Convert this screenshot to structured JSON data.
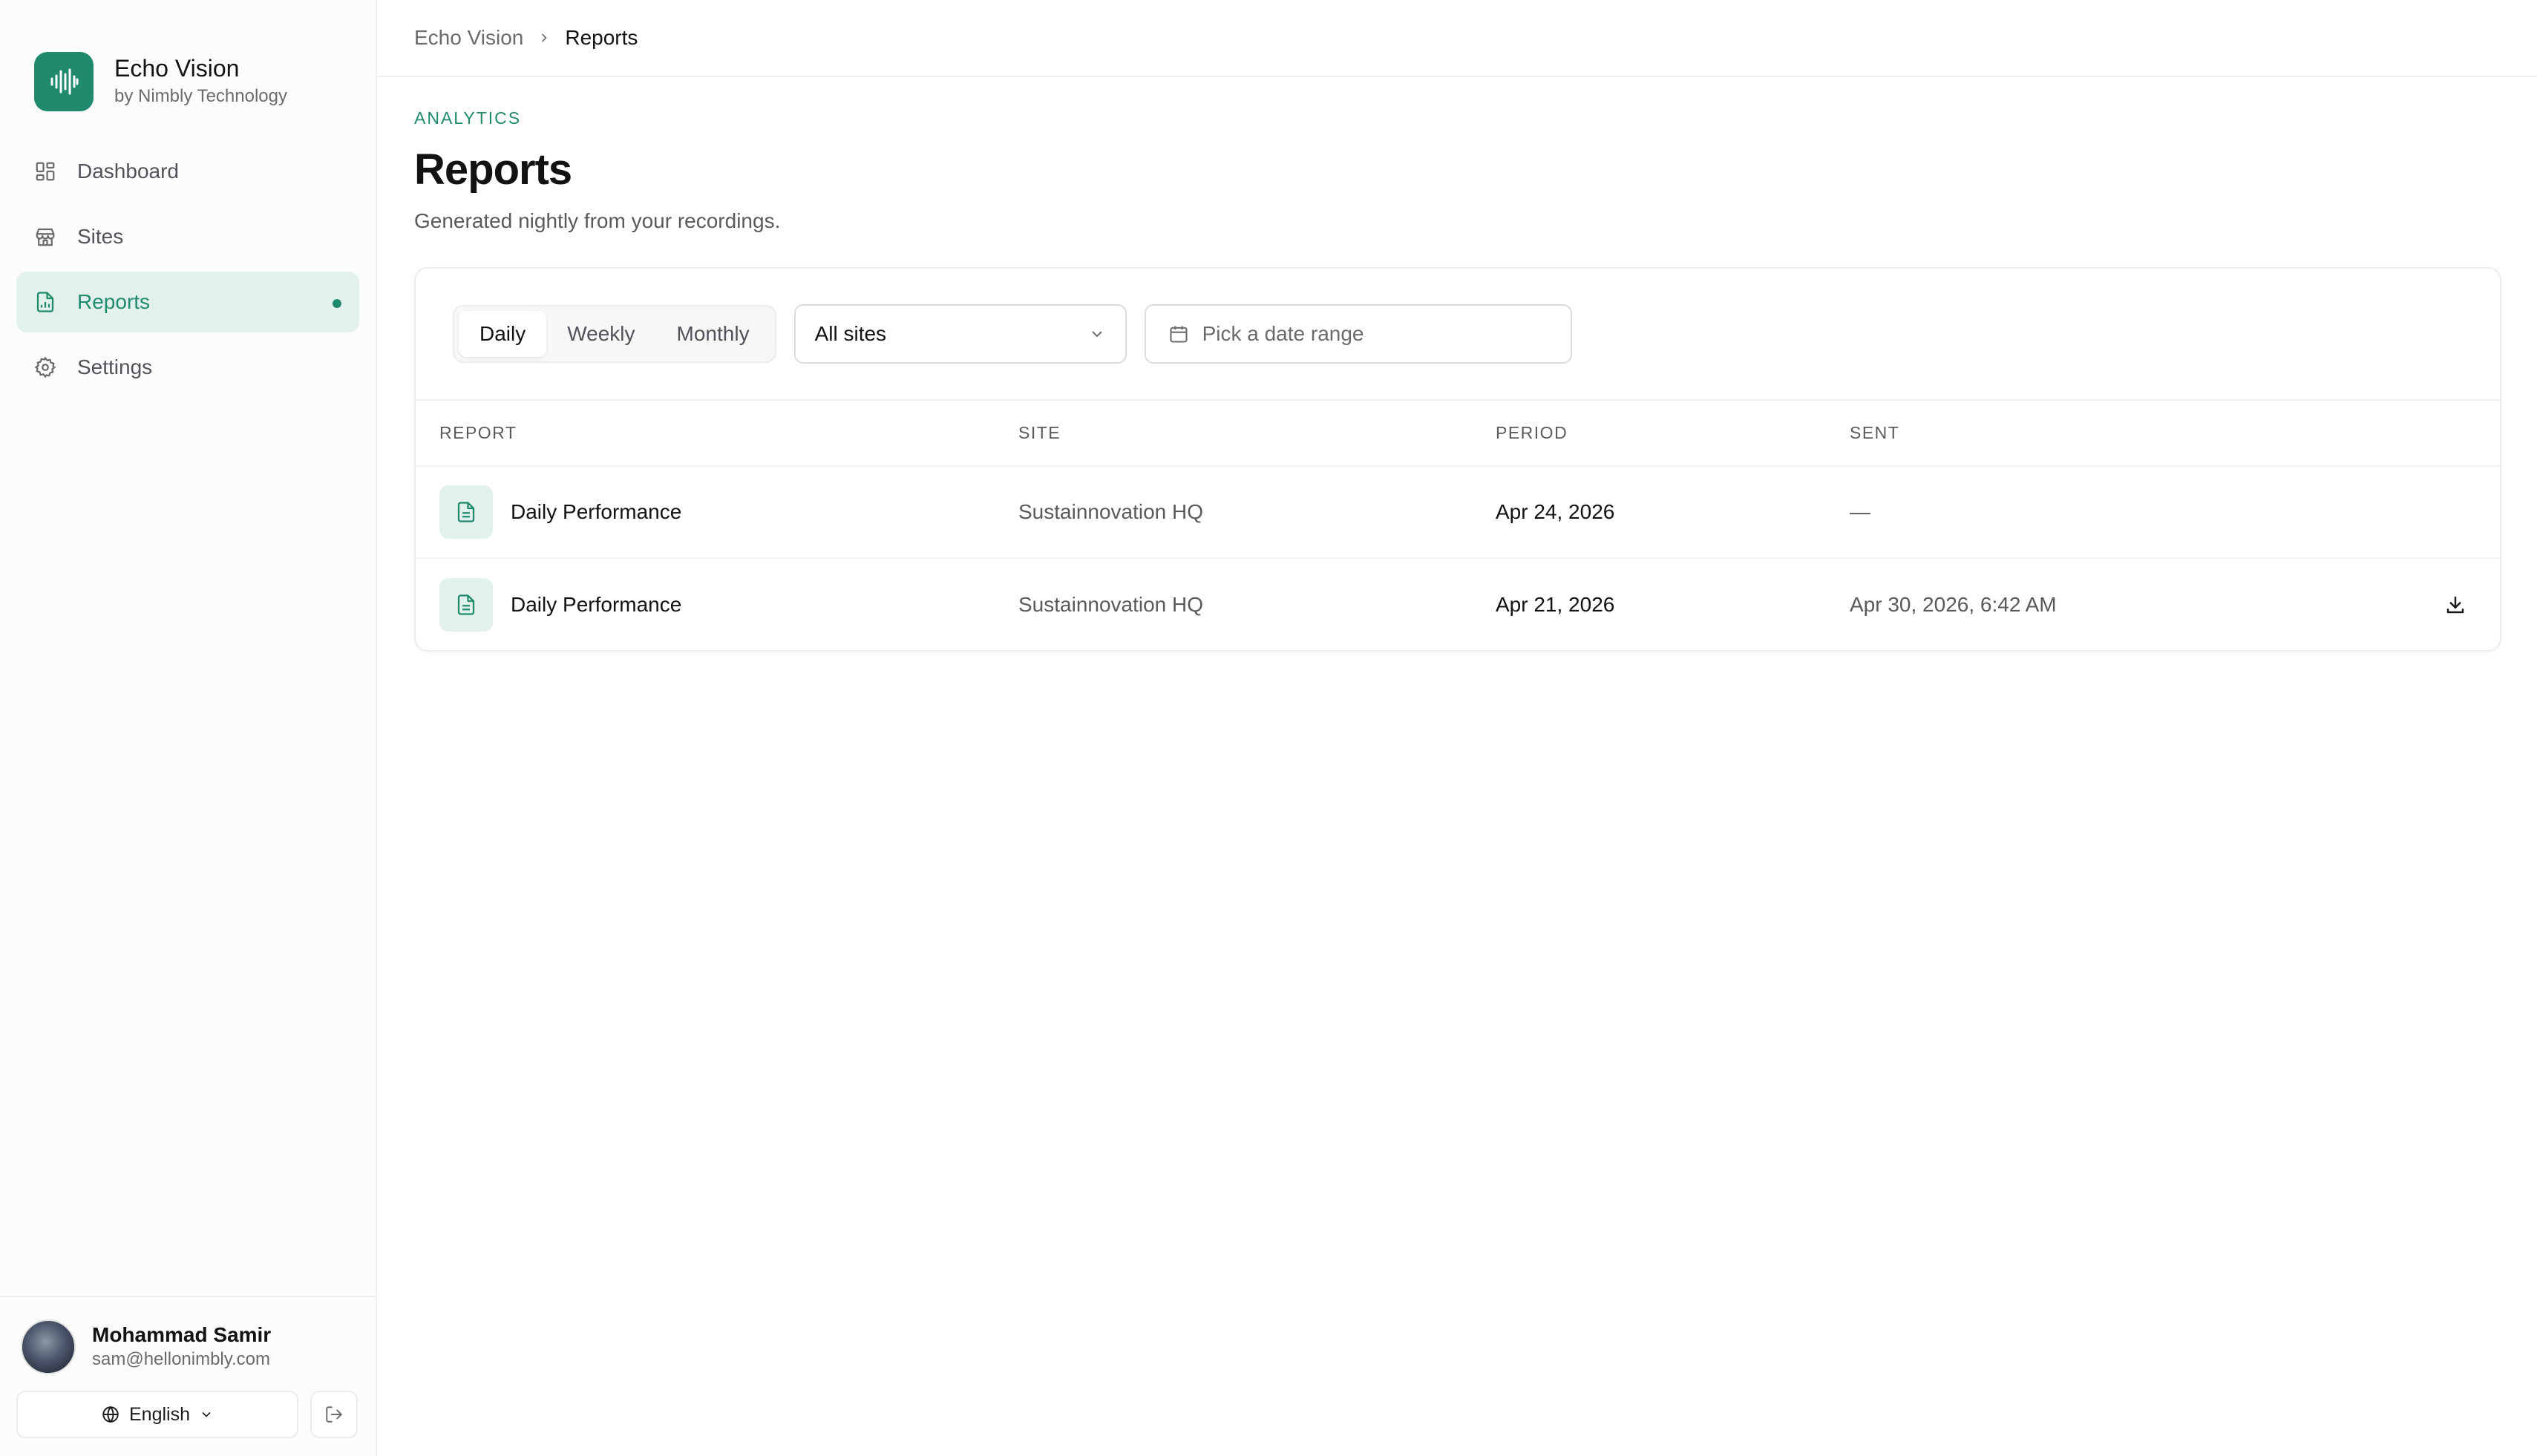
{
  "brand": {
    "name": "Echo Vision",
    "subtitle": "by Nimbly Technology",
    "accent": "#1f8a6c"
  },
  "sidebar": {
    "items": [
      {
        "label": "Dashboard",
        "icon": "grid-icon",
        "active": false
      },
      {
        "label": "Sites",
        "icon": "store-icon",
        "active": false
      },
      {
        "label": "Reports",
        "icon": "file-chart-icon",
        "active": true
      },
      {
        "label": "Settings",
        "icon": "gear-icon",
        "active": false
      }
    ]
  },
  "user": {
    "name": "Mohammad Samir",
    "email": "sam@hellonimbly.com"
  },
  "language": {
    "selected": "English"
  },
  "breadcrumb": {
    "root": "Echo Vision",
    "current": "Reports"
  },
  "page": {
    "eyebrow": "ANALYTICS",
    "title": "Reports",
    "subtitle": "Generated nightly from your recordings."
  },
  "filters": {
    "period_tabs": [
      "Daily",
      "Weekly",
      "Monthly"
    ],
    "active_tab": "Daily",
    "site_select": "All sites",
    "date_placeholder": "Pick a date range"
  },
  "table": {
    "headers": [
      "REPORT",
      "SITE",
      "PERIOD",
      "SENT"
    ],
    "rows": [
      {
        "report": "Daily Performance",
        "site": "Sustainnovation HQ",
        "period": "Apr 24, 2026",
        "sent": "—",
        "downloadable": false
      },
      {
        "report": "Daily Performance",
        "site": "Sustainnovation HQ",
        "period": "Apr 21, 2026",
        "sent": "Apr 30, 2026, 6:42 AM",
        "downloadable": true
      }
    ]
  }
}
